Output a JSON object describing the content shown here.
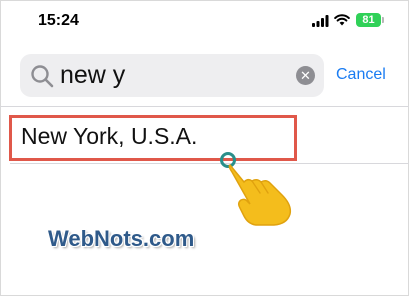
{
  "status_bar": {
    "time": "15:24",
    "battery_level": "81",
    "icons": [
      "signal-icon",
      "wifi-icon",
      "battery-icon"
    ],
    "battery_color": "#30d158"
  },
  "search": {
    "query": "new y",
    "clear_icon": "clear-icon",
    "cancel_label": "Cancel",
    "accent_color": "#1a7cf2"
  },
  "results": [
    {
      "label": "New York, U.S.A."
    }
  ],
  "overlay": {
    "highlight_color": "#e0584a",
    "pointer_icon": "tap-hand-icon",
    "watermark": "WebNots.com"
  }
}
